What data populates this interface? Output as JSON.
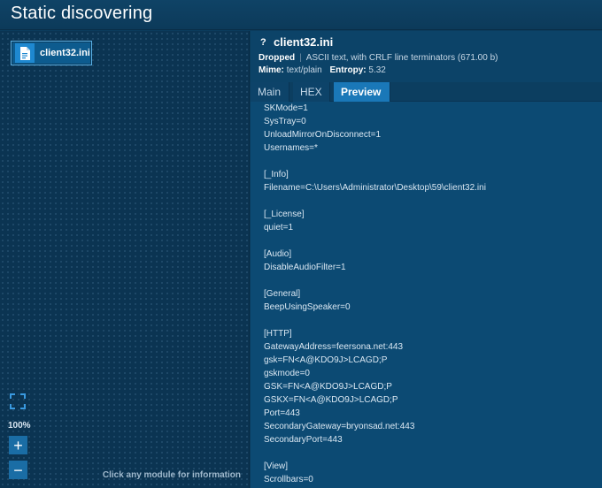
{
  "window": {
    "title": "Static discovering"
  },
  "graph": {
    "node_label": "client32.ini",
    "zoom": "100%",
    "hint": "Click any module for information"
  },
  "file_info": {
    "name": "client32.ini",
    "type_label": "Dropped",
    "description": "ASCII text, with CRLF line terminators (671.00 b)",
    "mime_label": "Mime:",
    "mime_value": "text/plain",
    "entropy_label": "Entropy:",
    "entropy_value": "5.32"
  },
  "tabs": [
    {
      "label": "Main",
      "active": false
    },
    {
      "label": "HEX",
      "active": false
    },
    {
      "label": "Preview",
      "active": true
    }
  ],
  "preview_lines": [
    "SKMode=1",
    "SysTray=0",
    "UnloadMirrorOnDisconnect=1",
    "Usernames=*",
    "",
    "[_Info]",
    "Filename=C:\\Users\\Administrator\\Desktop\\59\\client32.ini",
    "",
    "[_License]",
    "quiet=1",
    "",
    "[Audio]",
    "DisableAudioFilter=1",
    "",
    "[General]",
    "BeepUsingSpeaker=0",
    "",
    "[HTTP]",
    "GatewayAddress=feersona.net:443",
    "gsk=FN<A@KDO9J>LCAGD;P",
    "gskmode=0",
    "GSK=FN<A@KDO9J>LCAGD;P",
    "GSKX=FN<A@KDO9J>LCAGD;P",
    "Port=443",
    "SecondaryGateway=bryonsad.net:443",
    "SecondaryPort=443",
    "",
    "[View]",
    "Scrollbars=0"
  ],
  "icons": {
    "node": "document-icon",
    "fit": "fit-screen-icon",
    "zoom_in": "plus-icon",
    "zoom_out": "minus-icon",
    "unknown_type": "question-icon"
  },
  "colors": {
    "background": "#0b3b5c",
    "accent": "#1a78b8",
    "node_border": "#5ab0e6"
  }
}
